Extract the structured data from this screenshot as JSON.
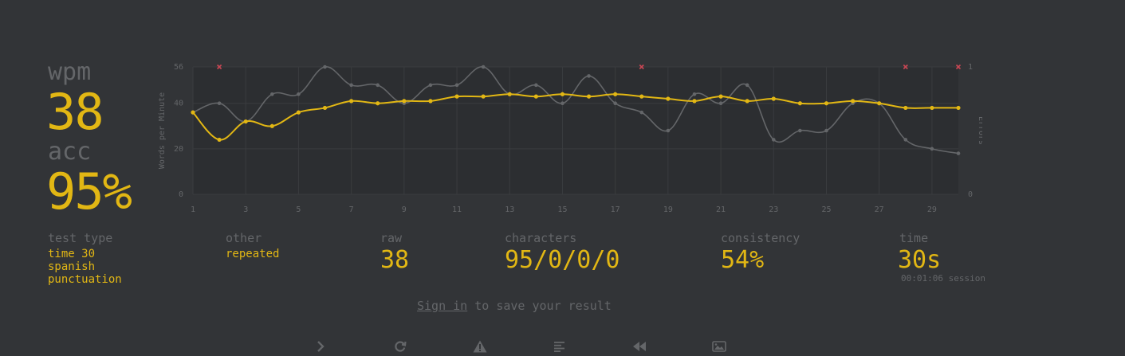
{
  "stats": {
    "wpm_label": "wpm",
    "wpm_value": "38",
    "acc_label": "acc",
    "acc_value": "95%"
  },
  "details": {
    "test_type_label": "test type",
    "test_type_values": [
      "time 30",
      "spanish",
      "punctuation"
    ],
    "other_label": "other",
    "other_value": "repeated",
    "raw_label": "raw",
    "raw_value": "38",
    "characters_label": "characters",
    "characters_value": "95/0/0/0",
    "consistency_label": "consistency",
    "consistency_value": "54%",
    "time_label": "time",
    "time_value": "30s",
    "session_value": "00:01:06 session"
  },
  "signin": {
    "link": "Sign in",
    "text": " to save your result"
  },
  "buttons": [
    {
      "name": "next-test-button",
      "icon": "chevron-right-icon"
    },
    {
      "name": "restart-test-button",
      "icon": "refresh-icon"
    },
    {
      "name": "practice-missed-button",
      "icon": "warning-icon"
    },
    {
      "name": "show-words-history-button",
      "icon": "align-left-icon"
    },
    {
      "name": "replay-button",
      "icon": "backward-icon"
    },
    {
      "name": "save-screenshot-button",
      "icon": "image-icon"
    }
  ],
  "colors": {
    "background": "#323437",
    "main": "#e2b714",
    "sub": "#646669",
    "error": "#ca4754"
  },
  "chart_data": {
    "type": "line",
    "x": [
      1,
      2,
      3,
      4,
      5,
      6,
      7,
      8,
      9,
      10,
      11,
      12,
      13,
      14,
      15,
      16,
      17,
      18,
      19,
      20,
      21,
      22,
      23,
      24,
      25,
      26,
      27,
      28,
      29,
      30
    ],
    "x_ticks": [
      1,
      3,
      5,
      7,
      9,
      11,
      13,
      15,
      17,
      19,
      21,
      23,
      25,
      27,
      29
    ],
    "ylabel": "Words per Minute",
    "y2label": "Errors",
    "ylim": [
      0,
      56
    ],
    "y_ticks": [
      0,
      20,
      40,
      56
    ],
    "y2lim": [
      0,
      1
    ],
    "y2_ticks": [
      0,
      1
    ],
    "series": [
      {
        "role": "raw",
        "color": "#646669",
        "values": [
          36,
          40,
          32,
          44,
          44,
          56,
          48,
          48,
          40,
          48,
          48,
          56,
          44,
          48,
          40,
          52,
          40,
          36,
          28,
          44,
          40,
          48,
          24,
          28,
          28,
          40,
          40,
          24,
          20,
          18
        ]
      },
      {
        "role": "wpm",
        "color": "#e2b714",
        "values": [
          36,
          24,
          32,
          30,
          36,
          38,
          41,
          40,
          41,
          41,
          43,
          43,
          44,
          43,
          44,
          43,
          44,
          43,
          42,
          41,
          43,
          41,
          42,
          40,
          40,
          41,
          40,
          38,
          38,
          38
        ]
      }
    ],
    "errors": [
      2,
      18,
      28,
      30
    ]
  }
}
